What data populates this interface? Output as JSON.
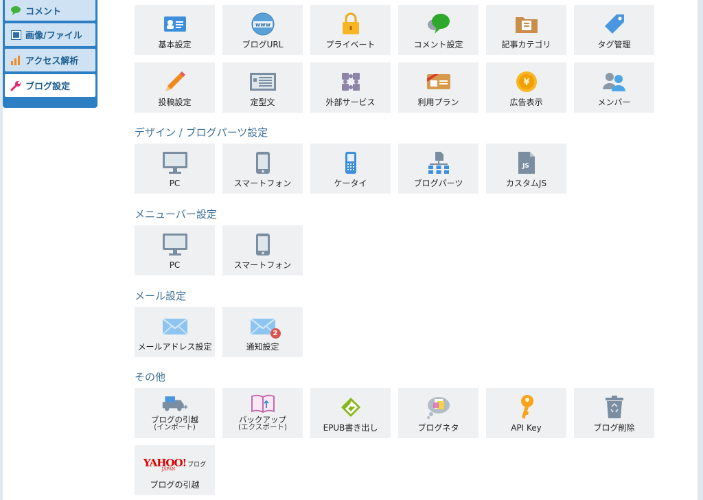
{
  "sidebar": {
    "items": [
      {
        "label": "コメント",
        "icon": "comment-icon"
      },
      {
        "label": "画像/ファイル",
        "icon": "image-file-icon"
      },
      {
        "label": "アクセス解析",
        "icon": "bar-chart-icon"
      },
      {
        "label": "ブログ設定",
        "icon": "wrench-icon",
        "active": true
      }
    ]
  },
  "basic": {
    "tiles": [
      {
        "label": "基本設定",
        "icon": "id-card-icon"
      },
      {
        "label": "ブログURL",
        "icon": "www-globe-icon"
      },
      {
        "label": "プライベート",
        "icon": "padlock-icon"
      },
      {
        "label": "コメント設定",
        "icon": "speech-bubble-icon"
      },
      {
        "label": "記事カテゴリ",
        "icon": "folder-icon"
      },
      {
        "label": "タグ管理",
        "icon": "tag-icon"
      },
      {
        "label": "投稿設定",
        "icon": "pencil-icon"
      },
      {
        "label": "定型文",
        "icon": "template-doc-icon"
      },
      {
        "label": "外部サービス",
        "icon": "puzzle-icon"
      },
      {
        "label": "利用プラン",
        "icon": "plan-card-icon"
      },
      {
        "label": "広告表示",
        "icon": "yen-coin-icon"
      },
      {
        "label": "メンバー",
        "icon": "members-icon"
      }
    ]
  },
  "design": {
    "title": "デザイン / ブログパーツ設定",
    "tiles": [
      {
        "label": "PC",
        "icon": "monitor-icon"
      },
      {
        "label": "スマートフォン",
        "icon": "smartphone-icon"
      },
      {
        "label": "ケータイ",
        "icon": "feature-phone-icon"
      },
      {
        "label": "ブログパーツ",
        "icon": "blog-parts-icon"
      },
      {
        "label": "カスタムJS",
        "icon": "js-file-icon",
        "badge_text": "JS"
      }
    ]
  },
  "menubar": {
    "title": "メニューバー設定",
    "tiles": [
      {
        "label": "PC",
        "icon": "monitor-icon"
      },
      {
        "label": "スマートフォン",
        "icon": "smartphone-icon"
      }
    ]
  },
  "mail": {
    "title": "メール設定",
    "tiles": [
      {
        "label": "メールアドレス設定",
        "icon": "envelope-icon"
      },
      {
        "label": "通知設定",
        "icon": "envelope-notify-icon",
        "badge": "2"
      }
    ]
  },
  "other": {
    "title": "その他",
    "tiles": [
      {
        "label": "ブログの引越",
        "sublabel": "(インポート)",
        "icon": "moving-truck-icon"
      },
      {
        "label": "バックアップ",
        "sublabel": "(エクスポート)",
        "icon": "backup-book-icon"
      },
      {
        "label": "EPUB書き出し",
        "icon": "epub-icon"
      },
      {
        "label": "ブログネタ",
        "icon": "blog-neta-icon"
      },
      {
        "label": "API Key",
        "icon": "key-icon"
      },
      {
        "label": "ブログ削除",
        "icon": "trash-icon"
      },
      {
        "label": "ブログの引越",
        "icon": "yahoo-blog-logo",
        "logo_text": "YAHOO!",
        "logo_sub": "ブログ",
        "logo_small": "JAPAN"
      }
    ]
  },
  "colors": {
    "accent": "#2d7fc3",
    "section_title": "#3c6f97",
    "tile_bg": "#eef0f2"
  }
}
